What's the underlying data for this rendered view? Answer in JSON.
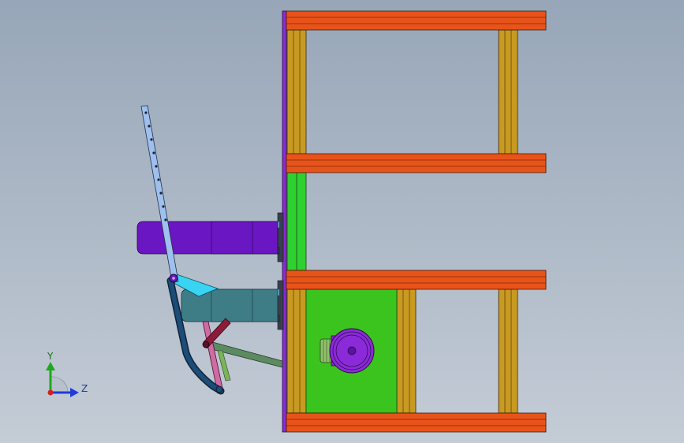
{
  "viewport": {
    "background_top": "#97a6b8",
    "background_bottom": "#c4ccd6"
  },
  "triad": {
    "y_label": "Y",
    "z_label": "Z",
    "y_color": "#1ea81e",
    "z_color": "#1e3cd8",
    "x_color": "#d81e1e"
  },
  "colors": {
    "frame_orange": "#e8531a",
    "frame_gold": "#c99a22",
    "panel_green": "#3cc41e",
    "strip_green": "#2fd02f",
    "purple": "#6a16c2",
    "teal_cylinder": "#3f7d86",
    "light_blue": "#7cc8ee",
    "cyan": "#38d4f2",
    "dark_blue_link": "#1c4c78",
    "rail_blue": "#9fc0ee",
    "pink": "#d06aa2",
    "maroon": "#8a1c3a",
    "green_link": "#5e8a62",
    "motor_purple": "#8a2ad8",
    "motor_green": "#8ec06a",
    "plate_purple": "#8a2ad8",
    "dark_block": "#3a3f50"
  }
}
